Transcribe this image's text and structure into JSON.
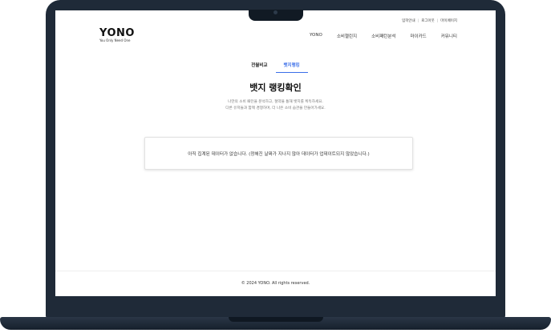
{
  "header": {
    "util_links": [
      "입학안내",
      "로그아웃",
      "마이페이지"
    ],
    "logo_main": "YONO",
    "logo_sub": "You Only Need One",
    "nav": [
      "YONO",
      "소비챌린지",
      "소비패턴분석",
      "마이카드",
      "커뮤니티"
    ]
  },
  "tabs": [
    "전월비교",
    "뱃지랭킹"
  ],
  "active_tab": "뱃지랭킹",
  "main": {
    "title": "뱃지 랭킹확인",
    "desc_line1": "나만의 소비 패턴을 분석하고, 절약을 통해 뱃지를 획득하세요.",
    "desc_line2": "다른 유저들과 함께 경쟁하며, 더 나은 소비 습관을 만들어가세요.",
    "message": "아직 집계된 데이터가 없습니다. (정해진 날짜가 지나지 않아 데이터가 업데이트되지 않았습니다.)"
  },
  "footer": {
    "copyright": "© 2024 YONO. All rights reserved."
  },
  "colors": {
    "accent": "#3a6ee8",
    "frame": "#1f2a38"
  }
}
